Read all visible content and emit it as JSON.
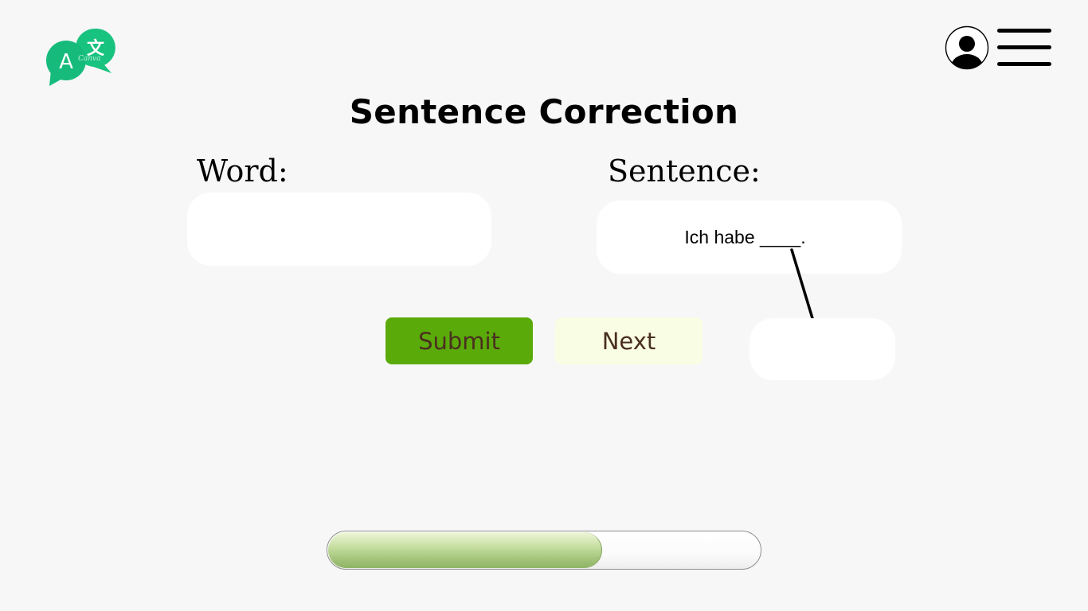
{
  "app": {
    "logo_icon": "translate-chat-bubbles-icon",
    "logo_watermark": "Canva",
    "logo_colors": {
      "primary": "#16bf7d"
    }
  },
  "header": {
    "profile_icon": "user-avatar-icon",
    "menu_icon": "hamburger-menu-icon"
  },
  "page": {
    "title": "Sentence Correction"
  },
  "word": {
    "label": "Word:",
    "value": "",
    "placeholder": ""
  },
  "sentence": {
    "label": "Sentence:",
    "text": "Ich habe ____.",
    "answer_value": ""
  },
  "actions": {
    "submit_label": "Submit",
    "next_label": "Next"
  },
  "progress": {
    "fraction": 0.63
  },
  "colors": {
    "background": "#f7f7f7",
    "submit": "#5aab0a",
    "next": "#f8fde3",
    "button_text": "#4a2f20",
    "progress_fill": "#a3c47a"
  }
}
